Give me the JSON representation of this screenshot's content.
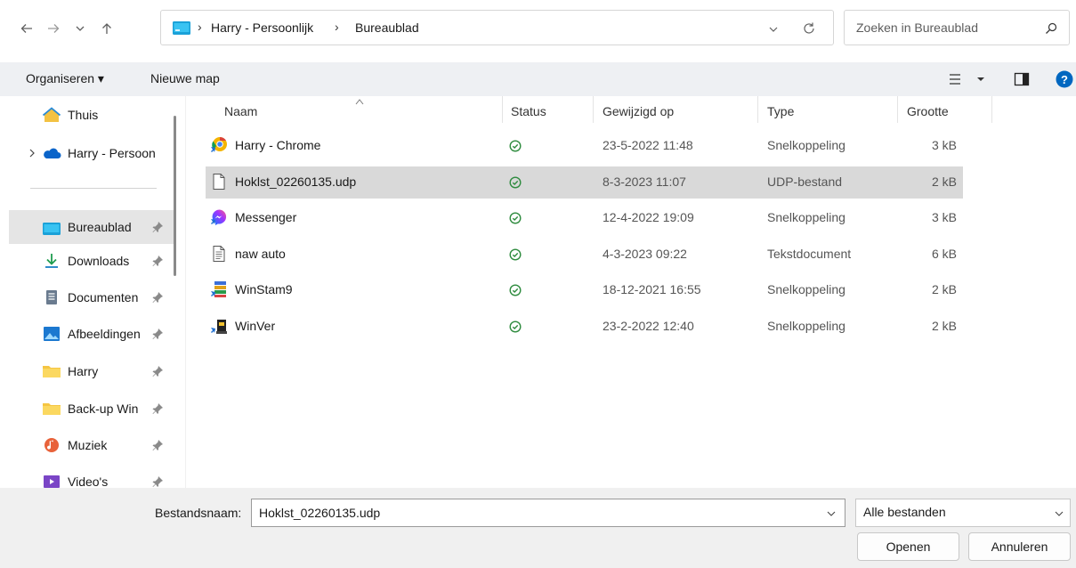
{
  "address": {
    "breadcrumbs": [
      "Harry - Persoonlijk",
      "Bureaublad"
    ],
    "separator": "›"
  },
  "search": {
    "placeholder": "Zoeken in Bureaublad"
  },
  "toolbar": {
    "organize_label": "Organiseren ▾",
    "new_folder_label": "Nieuwe map"
  },
  "sidebar": {
    "items": [
      {
        "label": "Thuis",
        "icon": "home-icon"
      },
      {
        "label": "Harry - Persoon",
        "icon": "onedrive-cloud-icon"
      },
      {
        "label": "Bureaublad",
        "icon": "desktop-folder-icon",
        "selected": true
      },
      {
        "label": "Downloads",
        "icon": "download-arrow-icon"
      },
      {
        "label": "Documenten",
        "icon": "documents-icon"
      },
      {
        "label": "Afbeeldingen",
        "icon": "pictures-icon"
      },
      {
        "label": "Harry",
        "icon": "folder-icon"
      },
      {
        "label": "Back-up Win",
        "icon": "folder-icon"
      },
      {
        "label": "Muziek",
        "icon": "music-icon"
      },
      {
        "label": "Video's",
        "icon": "videos-icon"
      }
    ]
  },
  "columns": {
    "name": "Naam",
    "status": "Status",
    "modified": "Gewijzigd op",
    "type": "Type",
    "size": "Grootte"
  },
  "files": [
    {
      "name": "Harry - Chrome",
      "modified": "23-5-2022 11:48",
      "type": "Snelkoppeling",
      "size": "3 kB",
      "icon": "chrome-shortcut-icon"
    },
    {
      "name": "Hoklst_02260135.udp",
      "modified": "8-3-2023 11:07",
      "type": "UDP-bestand",
      "size": "2 kB",
      "icon": "blank-file-icon",
      "selected": true
    },
    {
      "name": "Messenger",
      "modified": "12-4-2022 19:09",
      "type": "Snelkoppeling",
      "size": "3 kB",
      "icon": "messenger-icon"
    },
    {
      "name": "naw auto",
      "modified": "4-3-2023 09:22",
      "type": "Tekstdocument",
      "size": "6 kB",
      "icon": "text-file-icon"
    },
    {
      "name": "WinStam9",
      "modified": "18-12-2021 16:55",
      "type": "Snelkoppeling",
      "size": "2 kB",
      "icon": "winstam-shortcut-icon"
    },
    {
      "name": "WinVer",
      "modified": "23-2-2022 12:40",
      "type": "Snelkoppeling",
      "size": "2 kB",
      "icon": "winver-shortcut-icon"
    }
  ],
  "footer": {
    "filename_label": "Bestandsnaam:",
    "filename_value": "Hoklst_02260135.udp",
    "filetype_value": "Alle bestanden",
    "open_label": "Openen",
    "cancel_label": "Annuleren"
  },
  "colors": {
    "accent": "#0067c0",
    "selection": "#d9d9d9",
    "status_ok": "#2e8b3e",
    "command_bar": "#eef0f3",
    "footer": "#f0f0f0"
  }
}
